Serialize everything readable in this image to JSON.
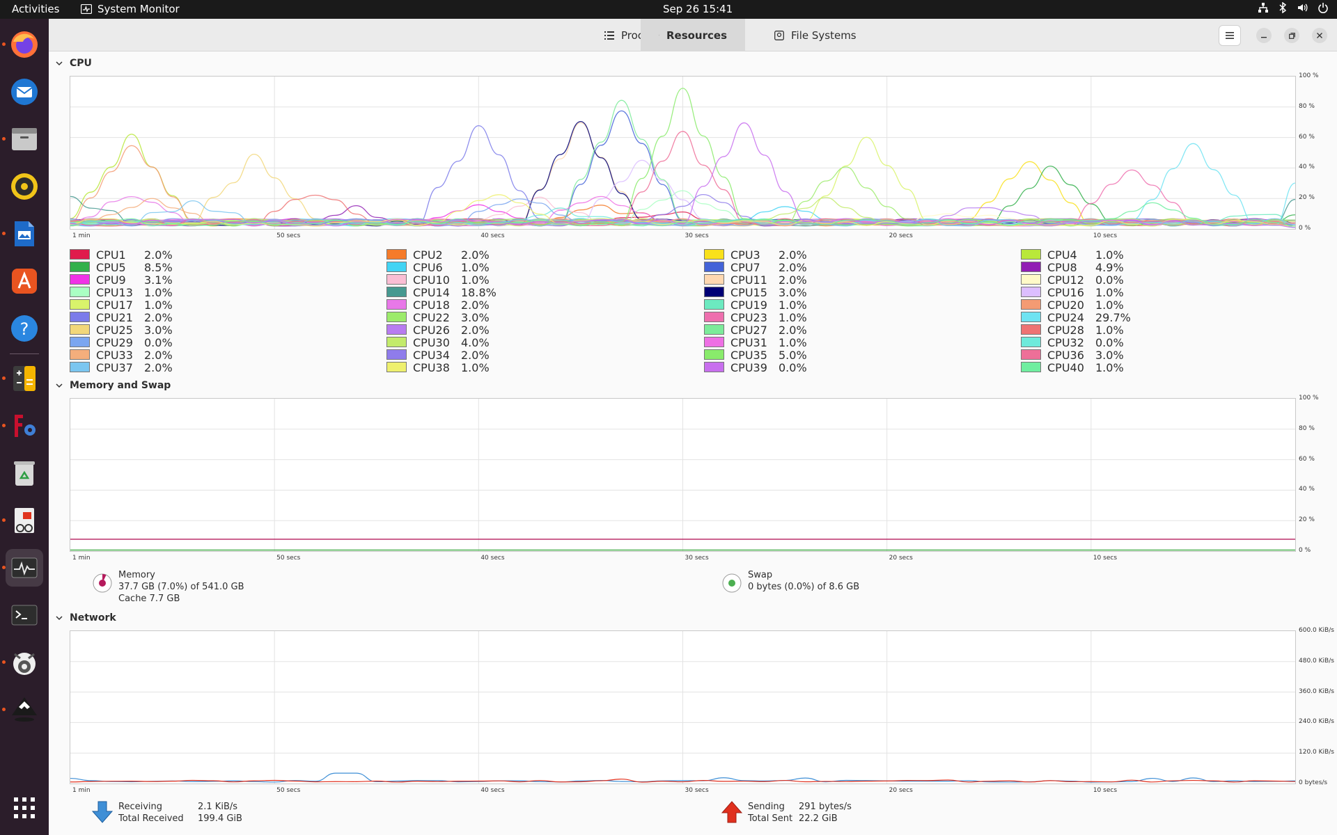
{
  "topbar": {
    "activities": "Activities",
    "app_name": "System Monitor",
    "clock": "Sep 26  15:41"
  },
  "dock": {
    "items": [
      {
        "name": "firefox-icon"
      },
      {
        "name": "thunderbird-icon"
      },
      {
        "name": "files-icon"
      },
      {
        "name": "rhythmbox-icon"
      },
      {
        "name": "writer-icon"
      },
      {
        "name": "app-center-icon"
      },
      {
        "name": "help-icon"
      },
      {
        "name": "calculator-icon"
      },
      {
        "name": "filezilla-icon"
      },
      {
        "name": "trash-icon"
      },
      {
        "name": "document-viewer-icon"
      },
      {
        "name": "system-monitor-icon"
      },
      {
        "name": "terminal-icon"
      },
      {
        "name": "gimp-icon"
      },
      {
        "name": "inkscape-icon"
      },
      {
        "name": "show-apps-icon"
      }
    ]
  },
  "tabs": [
    {
      "label": "Processes",
      "icon": "list-icon"
    },
    {
      "label": "Resources",
      "icon": "gauge-icon",
      "active": true
    },
    {
      "label": "File Systems",
      "icon": "disk-icon"
    }
  ],
  "cpu": {
    "title": "CPU",
    "y_ticks": [
      "100 %",
      "80 %",
      "60 %",
      "40 %",
      "20 %",
      "0 %"
    ],
    "x_ticks": [
      "1 min",
      "50 secs",
      "40 secs",
      "30 secs",
      "20 secs",
      "10 secs"
    ],
    "cores": [
      {
        "name": "CPU1",
        "value": "2.0%",
        "color": "#e01b4c"
      },
      {
        "name": "CPU2",
        "value": "2.0%",
        "color": "#f57b2a"
      },
      {
        "name": "CPU3",
        "value": "2.0%",
        "color": "#f9e11b"
      },
      {
        "name": "CPU4",
        "value": "1.0%",
        "color": "#b9e83a"
      },
      {
        "name": "CPU5",
        "value": "8.5%",
        "color": "#32b04b"
      },
      {
        "name": "CPU6",
        "value": "1.0%",
        "color": "#42d4f4"
      },
      {
        "name": "CPU7",
        "value": "2.0%",
        "color": "#4363d8"
      },
      {
        "name": "CPU8",
        "value": "4.9%",
        "color": "#911eb4"
      },
      {
        "name": "CPU9",
        "value": "3.1%",
        "color": "#f032e6"
      },
      {
        "name": "CPU10",
        "value": "1.0%",
        "color": "#fabed4"
      },
      {
        "name": "CPU11",
        "value": "2.0%",
        "color": "#ffd8b1"
      },
      {
        "name": "CPU12",
        "value": "0.0%",
        "color": "#fffac8"
      },
      {
        "name": "CPU13",
        "value": "1.0%",
        "color": "#aaffc3"
      },
      {
        "name": "CPU14",
        "value": "18.8%",
        "color": "#469990"
      },
      {
        "name": "CPU15",
        "value": "3.0%",
        "color": "#000075"
      },
      {
        "name": "CPU16",
        "value": "1.0%",
        "color": "#dcbeff"
      },
      {
        "name": "CPU17",
        "value": "1.0%",
        "color": "#d9f36b"
      },
      {
        "name": "CPU18",
        "value": "2.0%",
        "color": "#e878e8"
      },
      {
        "name": "CPU19",
        "value": "1.0%",
        "color": "#6ceac0"
      },
      {
        "name": "CPU20",
        "value": "1.0%",
        "color": "#f49b73"
      },
      {
        "name": "CPU21",
        "value": "2.0%",
        "color": "#7b7bea"
      },
      {
        "name": "CPU22",
        "value": "3.0%",
        "color": "#9ceb6b"
      },
      {
        "name": "CPU23",
        "value": "1.0%",
        "color": "#ee6fae"
      },
      {
        "name": "CPU24",
        "value": "29.7%",
        "color": "#6ee3f2"
      },
      {
        "name": "CPU25",
        "value": "3.0%",
        "color": "#f2d77a"
      },
      {
        "name": "CPU26",
        "value": "2.0%",
        "color": "#b87cf0"
      },
      {
        "name": "CPU27",
        "value": "2.0%",
        "color": "#7ceb9a"
      },
      {
        "name": "CPU28",
        "value": "1.0%",
        "color": "#ee7373"
      },
      {
        "name": "CPU29",
        "value": "0.0%",
        "color": "#7ba6f0"
      },
      {
        "name": "CPU30",
        "value": "4.0%",
        "color": "#c3eb6b"
      },
      {
        "name": "CPU31",
        "value": "1.0%",
        "color": "#ee6fe4"
      },
      {
        "name": "CPU32",
        "value": "0.0%",
        "color": "#6eeadb"
      },
      {
        "name": "CPU33",
        "value": "2.0%",
        "color": "#f4ae7c"
      },
      {
        "name": "CPU34",
        "value": "2.0%",
        "color": "#8f7ceb"
      },
      {
        "name": "CPU35",
        "value": "5.0%",
        "color": "#89eb6b"
      },
      {
        "name": "CPU36",
        "value": "3.0%",
        "color": "#ee6f98"
      },
      {
        "name": "CPU37",
        "value": "2.0%",
        "color": "#7bc6f0"
      },
      {
        "name": "CPU38",
        "value": "1.0%",
        "color": "#eef06e"
      },
      {
        "name": "CPU39",
        "value": "0.0%",
        "color": "#c86fee"
      },
      {
        "name": "CPU40",
        "value": "1.0%",
        "color": "#6feea0"
      }
    ]
  },
  "memory": {
    "title": "Memory and Swap",
    "y_ticks": [
      "100 %",
      "80 %",
      "60 %",
      "40 %",
      "20 %",
      "0 %"
    ],
    "x_ticks": [
      "1 min",
      "50 secs",
      "40 secs",
      "30 secs",
      "20 secs",
      "10 secs"
    ],
    "memory_label": "Memory",
    "memory_used": "37.7 GB (7.0%) of 541.0 GB",
    "memory_cache": "Cache 7.7 GB",
    "memory_fraction": 0.07,
    "swap_label": "Swap",
    "swap_used": "0 bytes (0.0%) of 8.6 GB",
    "memory_color": "#b51a5c",
    "swap_color": "#4caf50"
  },
  "network": {
    "title": "Network",
    "y_ticks": [
      "600.0 KiB/s",
      "480.0 KiB/s",
      "360.0 KiB/s",
      "240.0 KiB/s",
      "120.0 KiB/s",
      "0 bytes/s"
    ],
    "x_ticks": [
      "1 min",
      "50 secs",
      "40 secs",
      "30 secs",
      "20 secs",
      "10 secs"
    ],
    "receiving_label": "Receiving",
    "receiving_value": "2.1 KiB/s",
    "total_received_label": "Total Received",
    "total_received_value": "199.4 GiB",
    "sending_label": "Sending",
    "sending_value": "291 bytes/s",
    "total_sent_label": "Total Sent",
    "total_sent_value": "22.2 GiB",
    "receive_color": "#3f8fd6",
    "send_color": "#e0301e"
  }
}
